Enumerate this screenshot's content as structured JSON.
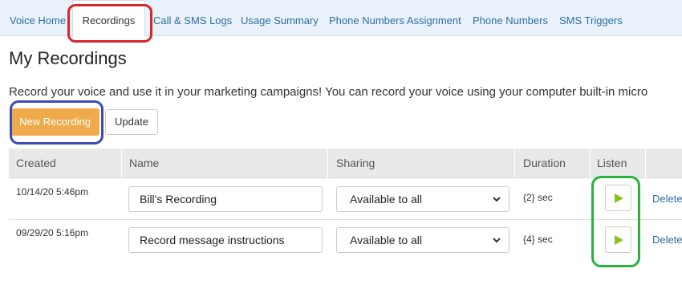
{
  "tabs": [
    {
      "label": "Voice Home"
    },
    {
      "label": "Recordings",
      "active": true
    },
    {
      "label": "Call & SMS Logs"
    },
    {
      "label": "Usage Summary"
    },
    {
      "label": "Phone Numbers Assignment"
    },
    {
      "label": "Phone Numbers"
    },
    {
      "label": "SMS Triggers"
    }
  ],
  "page": {
    "title": "My Recordings",
    "intro": "Record your voice and use it in your marketing campaigns! You can record your voice using your computer built-in micro"
  },
  "actions": {
    "new_label": "New Recording",
    "update_label": "Update"
  },
  "table": {
    "headers": {
      "created": "Created",
      "name": "Name",
      "sharing": "Sharing",
      "duration": "Duration",
      "listen": "Listen"
    },
    "rows": [
      {
        "created": "10/14/20 5:46pm",
        "name": "Bill's Recording",
        "sharing": "Available to all",
        "duration": "{2} sec",
        "delete": "Delete"
      },
      {
        "created": "09/29/20 5:16pm",
        "name": "Record message instructions",
        "sharing": "Available to all",
        "duration": "{4} sec",
        "delete": "Delete"
      }
    ]
  },
  "colors": {
    "accent_orange": "#eeaa4b",
    "link_blue": "#2a6ea6",
    "play_green": "#8cc21f",
    "annotation_red": "#d9242b",
    "annotation_blue": "#3d49b5",
    "annotation_green": "#2bb23c"
  },
  "icons": {
    "play": "play-icon",
    "dropdown": "chevron-down-icon"
  }
}
